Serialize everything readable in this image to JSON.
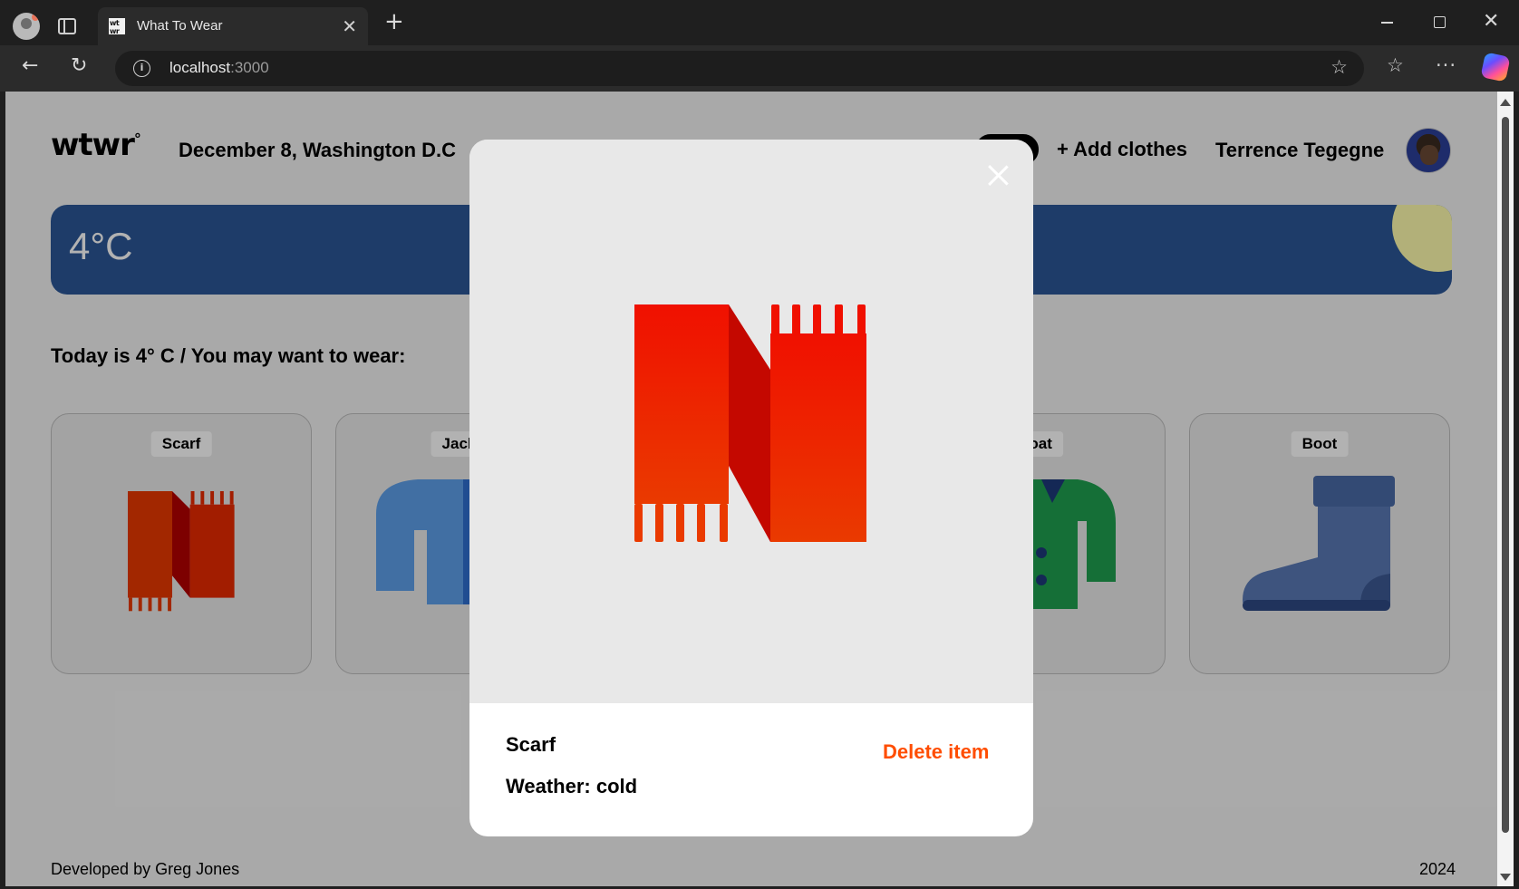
{
  "browser": {
    "tab_title": "What To Wear",
    "favicon_text": "wt wr",
    "url_host": "localhost",
    "url_port": ":3000"
  },
  "header": {
    "logo": "wtwr",
    "logo_degree": "°",
    "date_location": "December 8, Washington D.C",
    "add_clothes_label": "+ Add clothes",
    "username": "Terrence Tegegne"
  },
  "weather": {
    "temperature": "4°C"
  },
  "main": {
    "recommendation": "Today is 4° C / You may want to wear:",
    "cards": [
      {
        "label": "Scarf",
        "icon": "scarf-icon"
      },
      {
        "label": "Jacket",
        "icon": "jacket-icon"
      },
      {
        "label": "",
        "icon": "hidden-item"
      },
      {
        "label": "Coat",
        "icon": "coat-icon"
      },
      {
        "label": "Boot",
        "icon": "boot-icon"
      }
    ]
  },
  "modal": {
    "item_name": "Scarf",
    "weather_text": "Weather: cold",
    "delete_label": "Delete item",
    "image_icon": "scarf-icon"
  },
  "footer": {
    "credit": "Developed by Greg Jones",
    "year": "2024"
  },
  "colors": {
    "weather_bg": "#2c5797",
    "sun": "#fffdae",
    "delete": "#ff4d00",
    "scarf": "#e82a00"
  }
}
